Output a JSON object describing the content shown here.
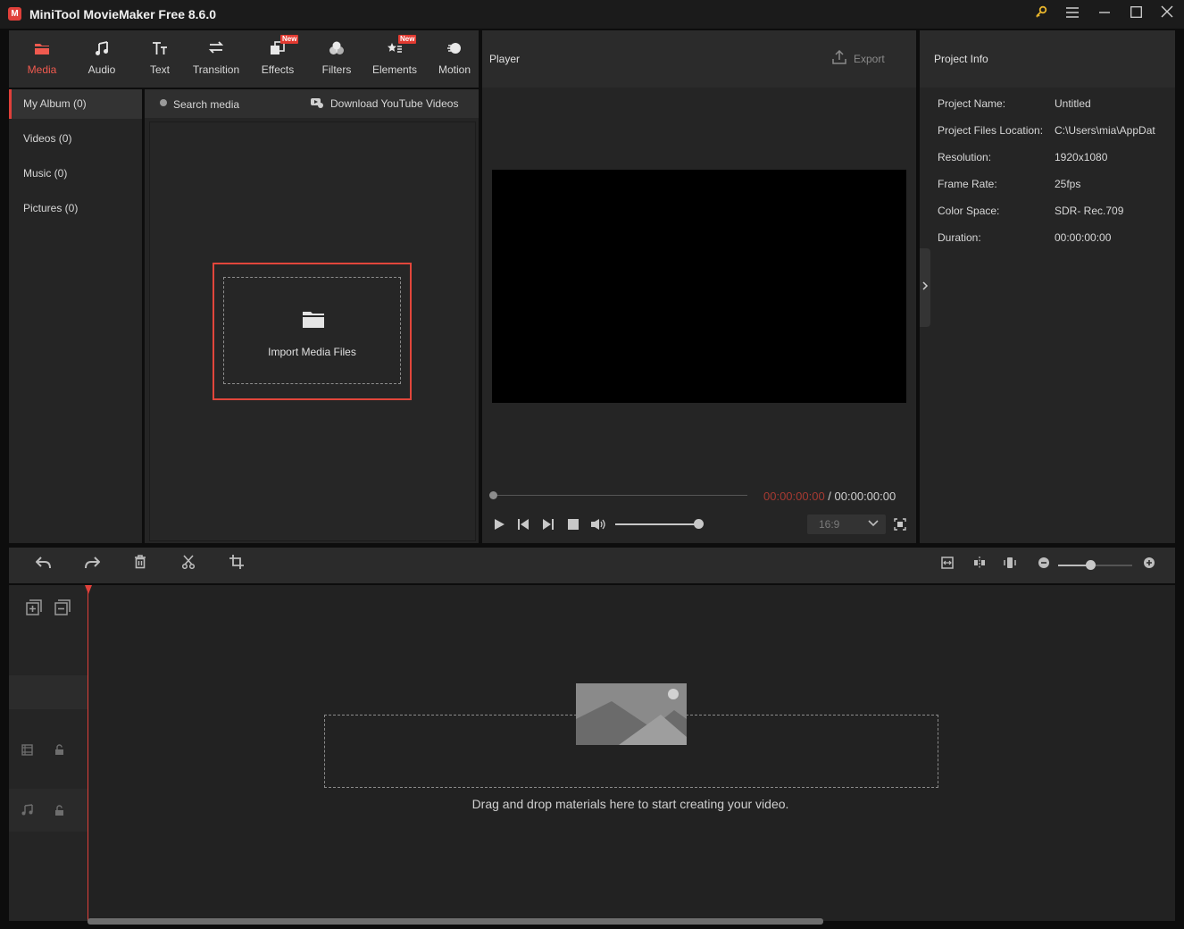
{
  "window": {
    "title": "MiniTool MovieMaker Free 8.6.0",
    "logo_letter": "M"
  },
  "toolbar": {
    "tabs": [
      {
        "label": "Media",
        "icon": "folder-icon"
      },
      {
        "label": "Audio",
        "icon": "music-note-icon"
      },
      {
        "label": "Text",
        "icon": "text-icon"
      },
      {
        "label": "Transition",
        "icon": "transition-icon"
      },
      {
        "label": "Effects",
        "icon": "effects-icon",
        "badge": "New"
      },
      {
        "label": "Filters",
        "icon": "filters-icon"
      },
      {
        "label": "Elements",
        "icon": "elements-icon",
        "badge": "New"
      },
      {
        "label": "Motion",
        "icon": "motion-icon"
      }
    ],
    "active": "Media"
  },
  "sidebar": {
    "items": [
      {
        "label": "My Album (0)"
      },
      {
        "label": "Videos (0)"
      },
      {
        "label": "Music (0)"
      },
      {
        "label": "Pictures (0)"
      }
    ]
  },
  "media": {
    "search_label": "Search media",
    "download_label": "Download YouTube Videos",
    "import_label": "Import Media Files"
  },
  "player": {
    "title": "Player",
    "export_label": "Export",
    "current_time": "00:00:00:00",
    "separator": " / ",
    "total_time": "00:00:00:00",
    "aspect_ratio": "16:9",
    "progress": 0,
    "volume": 1.0
  },
  "project_info": {
    "title": "Project Info",
    "rows": [
      {
        "label": "Project Name:",
        "value": "Untitled"
      },
      {
        "label": "Project Files Location:",
        "value": "C:\\Users\\mia\\AppDat"
      },
      {
        "label": "Resolution:",
        "value": "1920x1080"
      },
      {
        "label": "Frame Rate:",
        "value": "25fps"
      },
      {
        "label": "Color Space:",
        "value": "SDR- Rec.709"
      },
      {
        "label": "Duration:",
        "value": "00:00:00:00"
      }
    ]
  },
  "timeline": {
    "drop_hint": "Drag and drop materials here to start creating your video.",
    "zoom": 0.43
  },
  "colors": {
    "accent": "#e0403a",
    "panel": "#252525",
    "background": "#0d0d0d"
  }
}
